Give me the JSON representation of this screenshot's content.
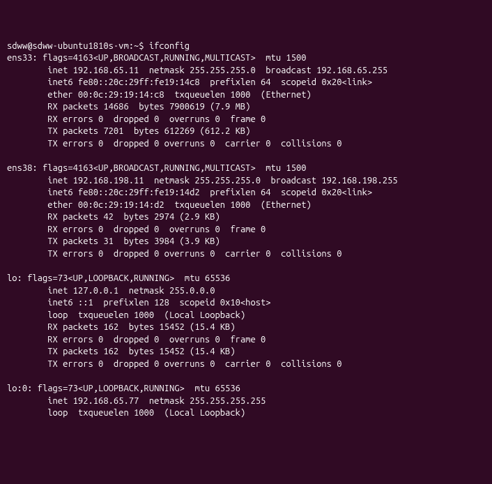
{
  "prompt": "sdww@sdww-ubuntu1810s-vm:~$ ",
  "command": "ifconfig",
  "ifaces": [
    {
      "name": "ens33",
      "flags": "flags=4163<UP,BROADCAST,RUNNING,MULTICAST>  mtu 1500",
      "lines": [
        "inet 192.168.65.11  netmask 255.255.255.0  broadcast 192.168.65.255",
        "inet6 fe80::20c:29ff:fe19:14c8  prefixlen 64  scopeid 0x20<link>",
        "ether 00:0c:29:19:14:c8  txqueuelen 1000  (Ethernet)",
        "RX packets 14686  bytes 7900619 (7.9 MB)",
        "RX errors 0  dropped 0  overruns 0  frame 0",
        "TX packets 7201  bytes 612269 (612.2 KB)",
        "TX errors 0  dropped 0 overruns 0  carrier 0  collisions 0"
      ]
    },
    {
      "name": "ens38",
      "flags": "flags=4163<UP,BROADCAST,RUNNING,MULTICAST>  mtu 1500",
      "lines": [
        "inet 192.168.198.11  netmask 255.255.255.0  broadcast 192.168.198.255",
        "inet6 fe80::20c:29ff:fe19:14d2  prefixlen 64  scopeid 0x20<link>",
        "ether 00:0c:29:19:14:d2  txqueuelen 1000  (Ethernet)",
        "RX packets 42  bytes 2974 (2.9 KB)",
        "RX errors 0  dropped 0  overruns 0  frame 0",
        "TX packets 31  bytes 3984 (3.9 KB)",
        "TX errors 0  dropped 0 overruns 0  carrier 0  collisions 0"
      ]
    },
    {
      "name": "lo",
      "flags": "flags=73<UP,LOOPBACK,RUNNING>  mtu 65536",
      "lines": [
        "inet 127.0.0.1  netmask 255.0.0.0",
        "inet6 ::1  prefixlen 128  scopeid 0x10<host>",
        "loop  txqueuelen 1000  (Local Loopback)",
        "RX packets 162  bytes 15452 (15.4 KB)",
        "RX errors 0  dropped 0  overruns 0  frame 0",
        "TX packets 162  bytes 15452 (15.4 KB)",
        "TX errors 0  dropped 0 overruns 0  carrier 0  collisions 0"
      ]
    },
    {
      "name": "lo:0",
      "flags": "flags=73<UP,LOOPBACK,RUNNING>  mtu 65536",
      "lines": [
        "inet 192.168.65.77  netmask 255.255.255.255",
        "loop  txqueuelen 1000  (Local Loopback)"
      ]
    }
  ]
}
